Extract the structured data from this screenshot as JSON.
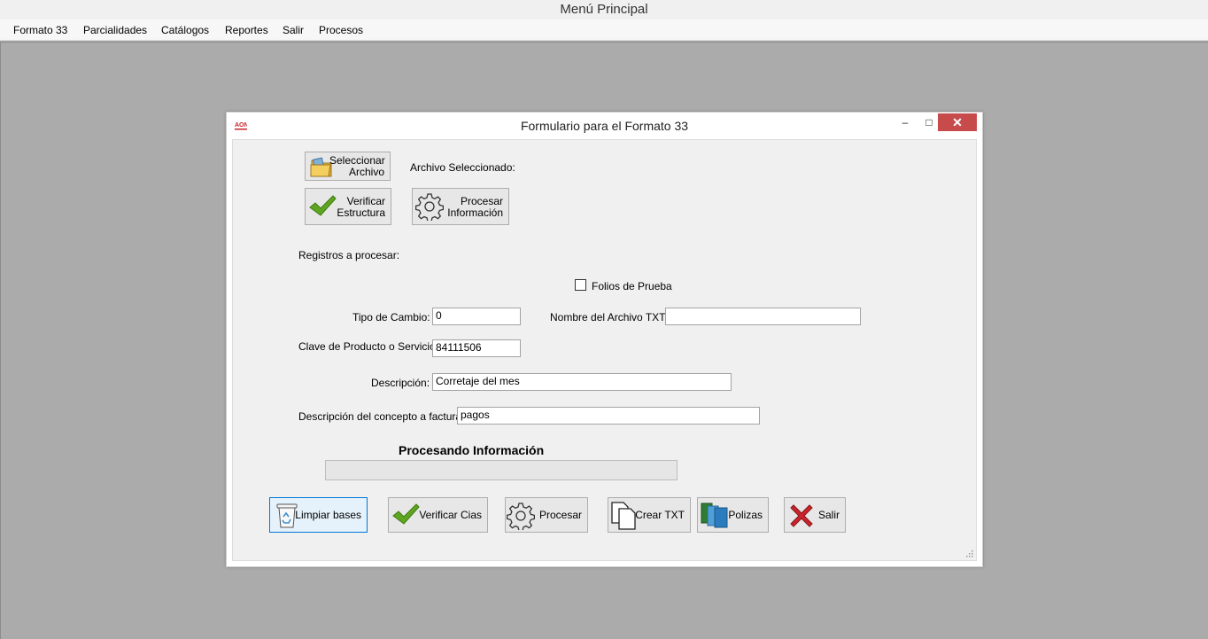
{
  "app": {
    "title": "Menú Principal"
  },
  "menu": {
    "items": [
      "Formato 33",
      "Parcialidades",
      "Catálogos",
      "Reportes",
      "Salir",
      "Procesos"
    ]
  },
  "form": {
    "title": "Formulario para el Formato 33",
    "window_controls": {
      "minimize": "–",
      "maximize": "□",
      "close": "✕"
    },
    "top_buttons": {
      "select_file": "Seleccionar Archivo",
      "verify_structure": "Verificar Estructura",
      "process_info": "Procesar Información"
    },
    "labels": {
      "selected_file": "Archivo Seleccionado:",
      "records_to_process": "Registros a procesar:",
      "test_folios": "Folios de Prueba",
      "exchange_rate": "Tipo de Cambio:",
      "txt_file_name": "Nombre del Archivo TXT",
      "product_key": "Clave de Producto o Servicio:",
      "description": "Descripción:",
      "concept_description": "Descripción del concepto a facturar:"
    },
    "fields": {
      "test_folios_checked": false,
      "exchange_rate": "0",
      "txt_file_name": "",
      "product_key": "84111506",
      "description": "Corretaje del mes",
      "concept_description": "pagos"
    },
    "progress": {
      "title": "Procesando Información",
      "value": 0
    },
    "bottom_buttons": {
      "clear_bases": "Limpiar bases",
      "verify_cias": "Verificar Cias",
      "process": "Procesar",
      "create_txt": "Crear TXT",
      "policies": "Polizas",
      "exit": "Salir"
    },
    "icons": {
      "select_file": "folder-icon",
      "verify_structure": "checkmark-icon",
      "process_info": "gear-icon",
      "clear_bases": "recycle-bin-icon",
      "verify_cias": "checkmark-icon",
      "process": "gear-icon",
      "create_txt": "copy-documents-icon",
      "policies": "books-icon",
      "exit": "red-x-icon"
    },
    "colors": {
      "close_button": "#c74b4b",
      "checkmark": "#5ea61f",
      "x_mark": "#c8252c",
      "focus_border": "#0078d7"
    }
  }
}
